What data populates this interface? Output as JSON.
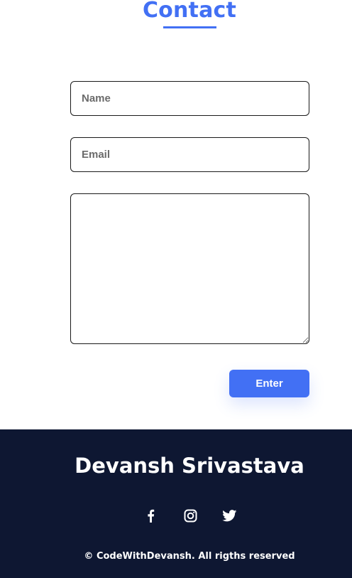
{
  "contact": {
    "title": "Contact"
  },
  "form": {
    "name_placeholder": "Name",
    "email_placeholder": "Email",
    "message_placeholder": "",
    "submit_label": "Enter"
  },
  "footer": {
    "name": "Devansh Srivastava",
    "social_icons": [
      "facebook-icon",
      "instagram-icon",
      "twitter-icon"
    ],
    "copyright": "© CodeWithDevansh. All rigths reserved"
  },
  "colors": {
    "accent": "#4270f4",
    "footer_background": "#0e1732"
  }
}
